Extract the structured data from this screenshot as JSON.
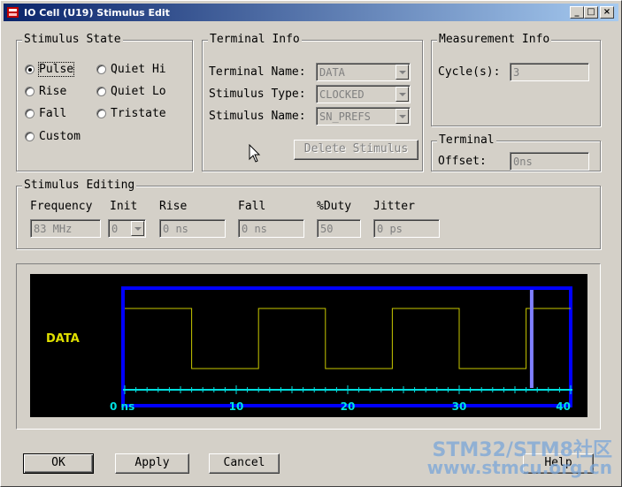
{
  "window": {
    "title": "IO Cell (U19) Stimulus Edit"
  },
  "stimulus_state": {
    "legend": "Stimulus State",
    "options": [
      {
        "label": "Pulse",
        "selected": true
      },
      {
        "label": "Quiet Hi",
        "selected": false
      },
      {
        "label": "Rise",
        "selected": false
      },
      {
        "label": "Quiet Lo",
        "selected": false
      },
      {
        "label": "Fall",
        "selected": false
      },
      {
        "label": "Tristate",
        "selected": false
      },
      {
        "label": "Custom",
        "selected": false
      }
    ]
  },
  "terminal_info": {
    "legend": "Terminal Info",
    "terminal_name_label": "Terminal Name:",
    "terminal_name_value": "DATA",
    "stimulus_type_label": "Stimulus Type:",
    "stimulus_type_value": "CLOCKED",
    "stimulus_name_label": "Stimulus Name:",
    "stimulus_name_value": "SN_PREFS",
    "delete_button": "Delete Stimulus"
  },
  "measurement_info": {
    "legend": "Measurement Info",
    "cycles_label": "Cycle(s):",
    "cycles_value": "3"
  },
  "terminal": {
    "legend": "Terminal",
    "offset_label": "Offset:",
    "offset_value": "0ns"
  },
  "stimulus_editing": {
    "legend": "Stimulus Editing",
    "frequency_label": "Frequency",
    "frequency_value": "83 MHz",
    "init_label": "Init",
    "init_value": "0",
    "rise_label": "Rise",
    "rise_value": "0 ns",
    "fall_label": "Fall",
    "fall_value": "0 ns",
    "duty_label": "%Duty",
    "duty_value": "50",
    "jitter_label": "Jitter",
    "jitter_value": "0 ps"
  },
  "waveform": {
    "signal_name": "DATA",
    "axis_labels": [
      "0 ns",
      "10",
      "20",
      "30",
      "40"
    ],
    "axis_range": [
      0,
      40
    ],
    "marker_time": 36.5,
    "edges": [
      {
        "t": 0,
        "level": "high"
      },
      {
        "t": 6,
        "level": "low"
      },
      {
        "t": 12,
        "level": "high"
      },
      {
        "t": 18,
        "level": "low"
      },
      {
        "t": 24,
        "level": "high"
      },
      {
        "t": 30,
        "level": "low"
      },
      {
        "t": 36,
        "level": "high"
      }
    ],
    "colors": {
      "signal": "#c8c800",
      "frame": "#0000ff",
      "axis": "#00e0e0",
      "marker": "#8080ff",
      "label": "#e0e000"
    }
  },
  "buttons": {
    "ok": "OK",
    "apply": "Apply",
    "cancel": "Cancel",
    "help": "Help"
  },
  "watermark": {
    "line1": "STM32/STM8社区",
    "line2": "www.stmcu.org.cn"
  }
}
